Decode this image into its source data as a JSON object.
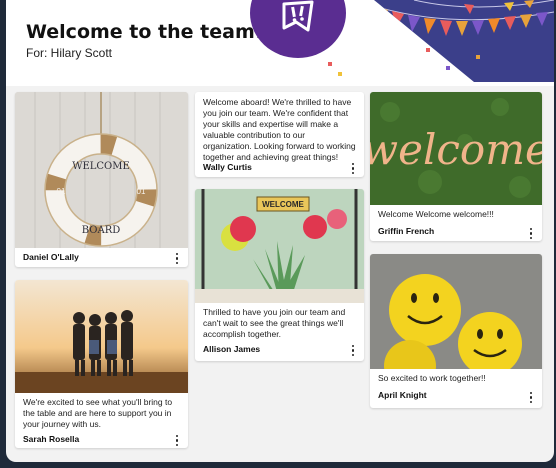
{
  "header": {
    "title": "Welcome to the team!",
    "recipient": "For: Hilary Scott",
    "badge_icon": "celebration-exclamation-icon",
    "colors": {
      "badge": "#5a2d91",
      "banner": "#3b3f8a"
    }
  },
  "cards": [
    {
      "id": "daniel",
      "author": "Daniel O'Lally",
      "message": "",
      "image": "life-ring-welcome-board",
      "image_text": [
        "WELCOME",
        "BOARD",
        "01",
        "01"
      ]
    },
    {
      "id": "sarah",
      "author": "Sarah Rosella",
      "message": "We're excited to see what you'll bring to the table and are here to support you in your journey with us.",
      "image": "friends-sunset"
    },
    {
      "id": "wally",
      "author": "Wally Curtis",
      "message": "Welcome aboard! We're thrilled to have you join our team. We're confident that your skills and expertise will make a valuable contribution to our organization. Looking forward to working together and achieving great things!",
      "image": ""
    },
    {
      "id": "allison",
      "author": "Allison James",
      "message": "Thrilled to have you join our team and can't wait to see the great things we'll accomplish together.",
      "image": "cactus-welcome-sign",
      "image_text": [
        "WELCOME"
      ]
    },
    {
      "id": "griffin",
      "author": "Griffin French",
      "message": "Welcome Welcome welcome!!!",
      "image": "welcome-grass-sign",
      "image_text": [
        "welcome"
      ]
    },
    {
      "id": "april",
      "author": "April Knight",
      "message": "So excited to work together!!",
      "image": "smiley-balls"
    }
  ],
  "icons": {
    "card_menu": "more-vertical-icon"
  }
}
